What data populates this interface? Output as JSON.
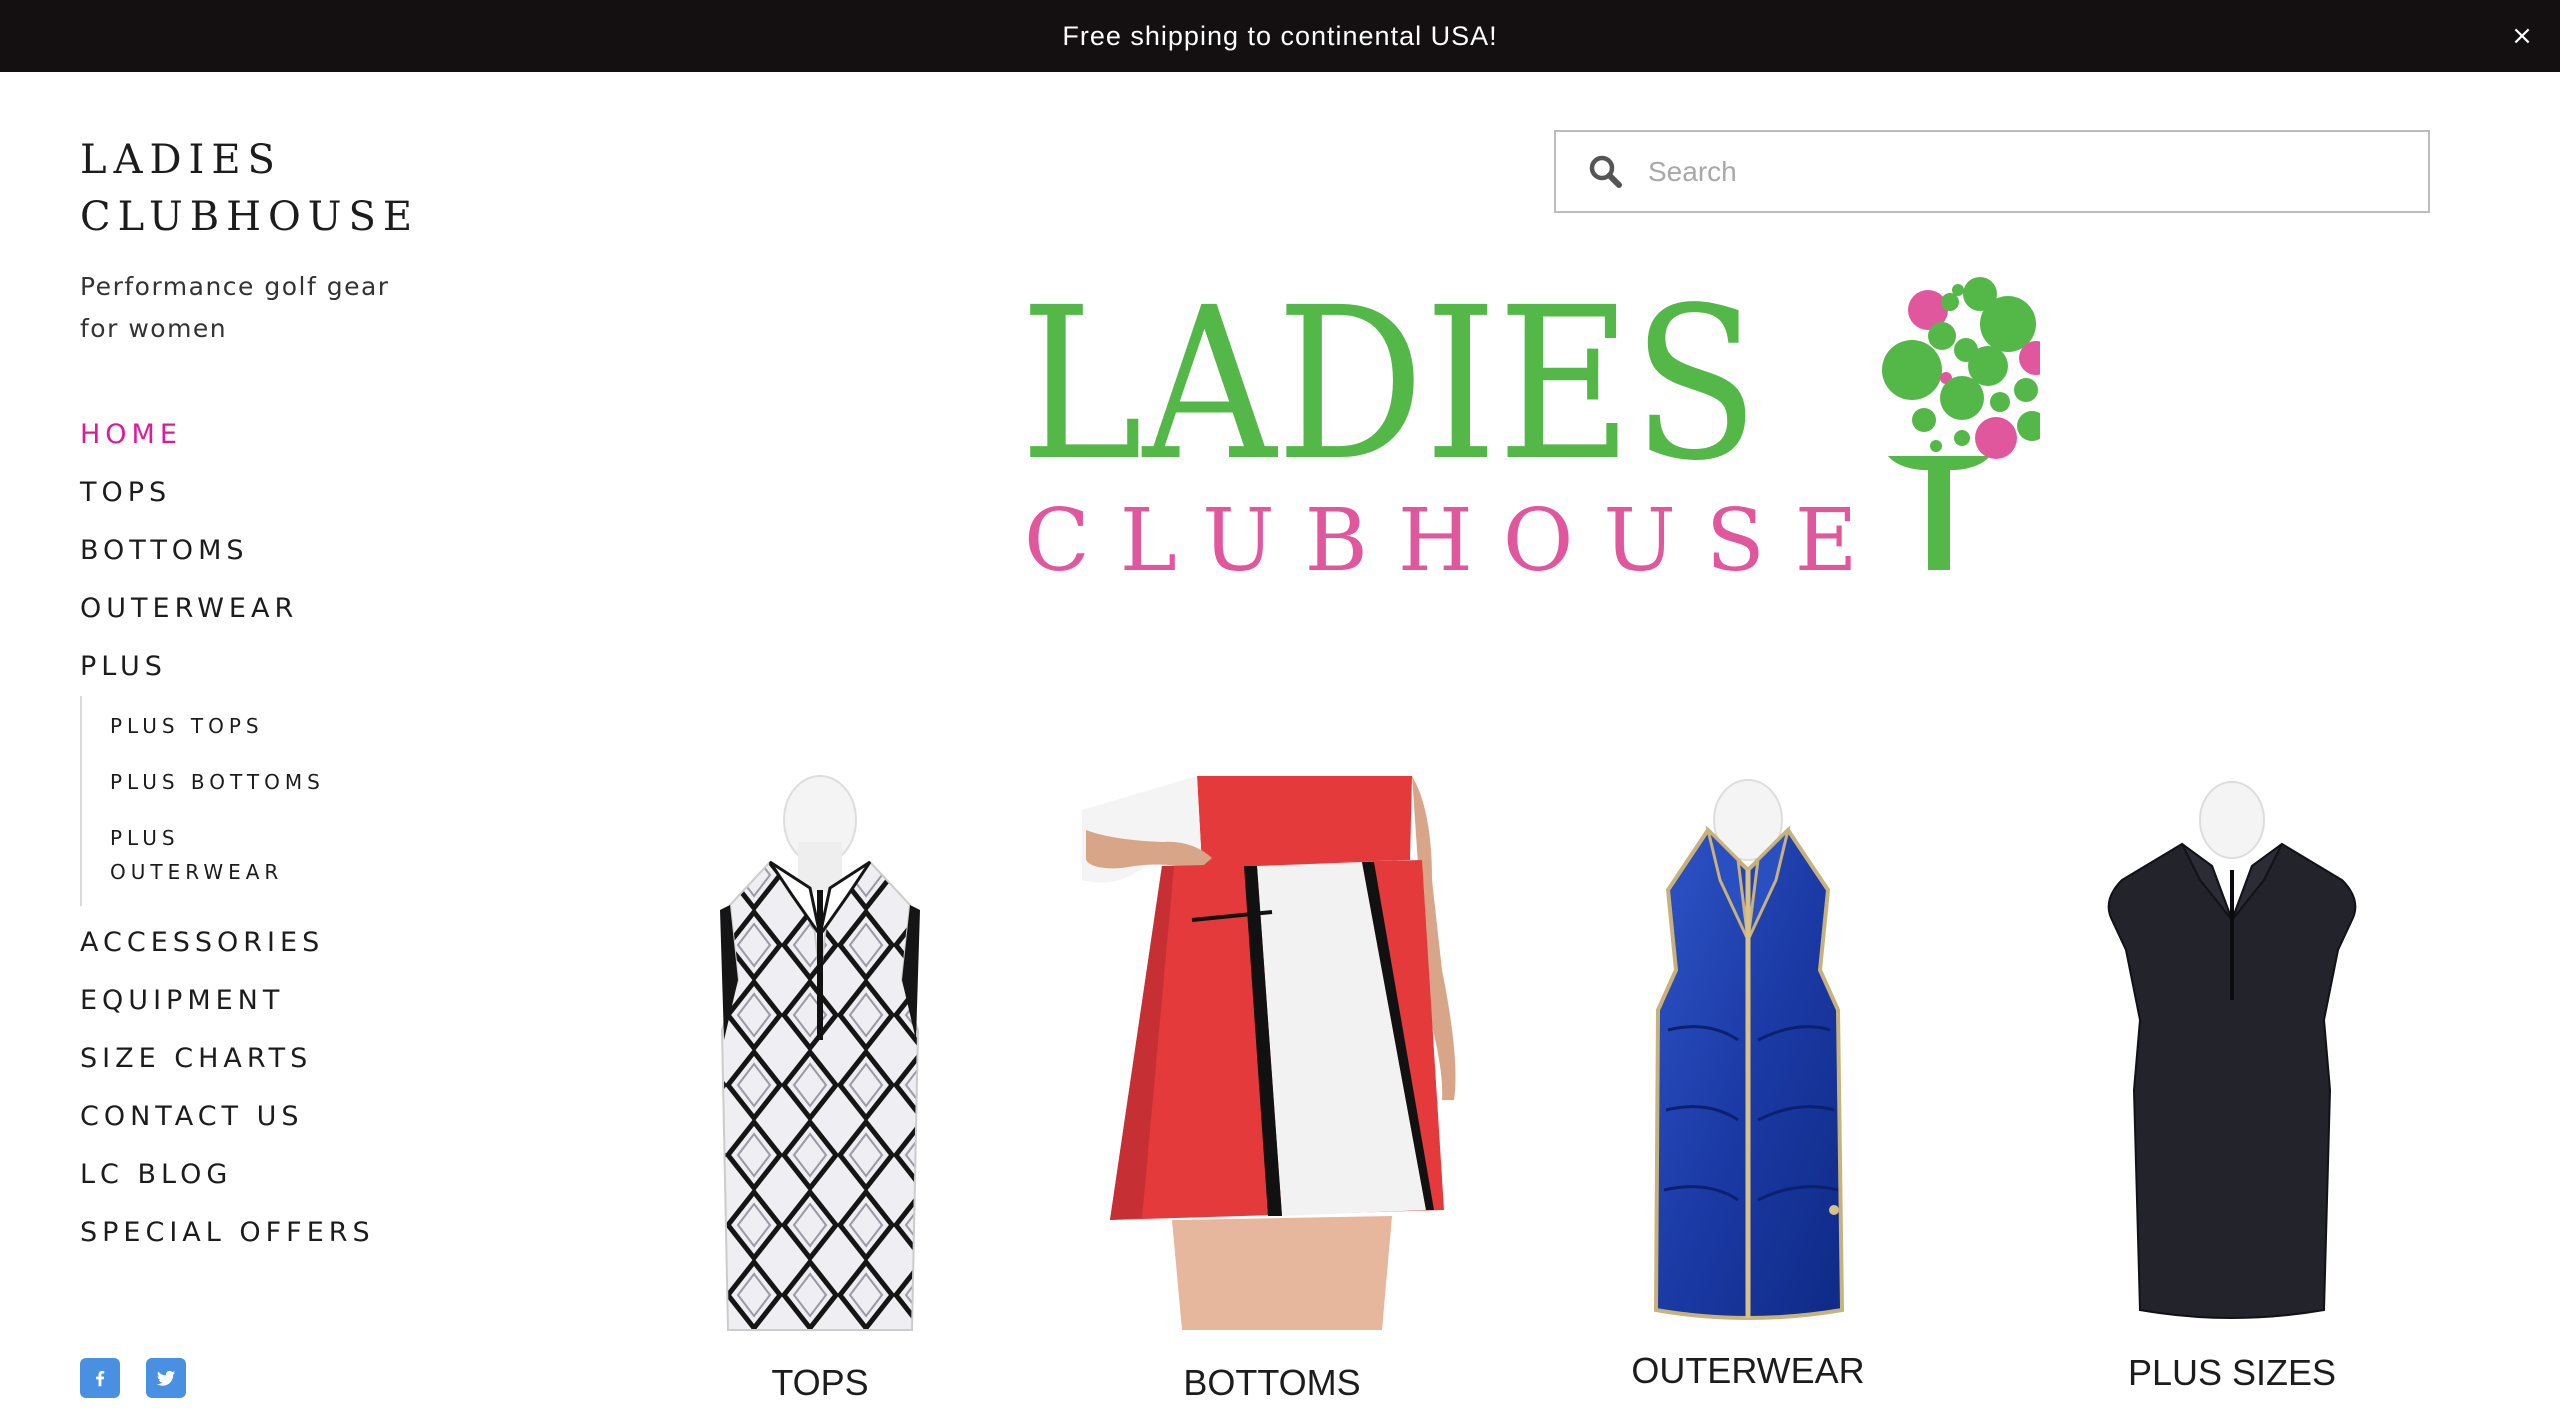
{
  "announcement": {
    "text": "Free shipping to continental USA!",
    "close_glyph": "×"
  },
  "site": {
    "title_line1": "LADIES",
    "title_line2": "CLUBHOUSE",
    "tagline": "Performance golf gear for women"
  },
  "nav": {
    "items": [
      {
        "label": "HOME",
        "active": true
      },
      {
        "label": "TOPS"
      },
      {
        "label": "BOTTOMS"
      },
      {
        "label": "OUTERWEAR"
      },
      {
        "label": "PLUS"
      }
    ],
    "plus_sub": [
      {
        "label": "PLUS TOPS"
      },
      {
        "label": "PLUS BOTTOMS"
      },
      {
        "label_line1": "PLUS",
        "label_line2": "OUTERWEAR"
      }
    ],
    "items_after": [
      {
        "label": "ACCESSORIES"
      },
      {
        "label": "EQUIPMENT"
      },
      {
        "label": "SIZE CHARTS"
      },
      {
        "label": "CONTACT US"
      },
      {
        "label": "LC BLOG"
      },
      {
        "label": "SPECIAL OFFERS"
      }
    ]
  },
  "social": [
    {
      "icon": "facebook-icon"
    },
    {
      "icon": "twitter-icon"
    }
  ],
  "search": {
    "placeholder": "Search",
    "value": ""
  },
  "logo": {
    "word1": "LADIES",
    "word2": "CLUBHOUSE"
  },
  "categories": [
    {
      "label": "TOPS",
      "icon": "sleeveless-argyle-top-image"
    },
    {
      "label": "BOTTOMS",
      "icon": "red-white-skort-image"
    },
    {
      "label": "OUTERWEAR",
      "icon": "blue-vest-image"
    },
    {
      "label": "PLUS SIZES",
      "icon": "navy-polo-image"
    }
  ],
  "colors": {
    "announce_bg": "#140f10",
    "accent_active": "#e0189a",
    "logo_green": "#54b848",
    "logo_pink": "#e0579e",
    "social_blue": "#4a90e2"
  }
}
